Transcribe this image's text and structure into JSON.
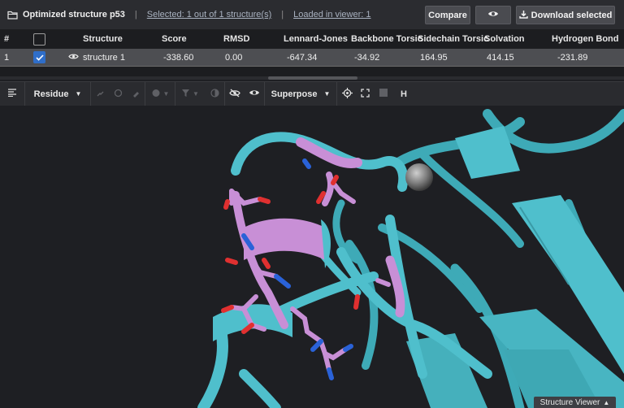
{
  "header": {
    "title": "Optimized structure p53",
    "selected_text": "Selected: 1 out of 1 structure(s)",
    "loaded_text": "Loaded in viewer: 1",
    "separator": "|",
    "compare_label": "Compare",
    "download_label": "Download selected"
  },
  "table": {
    "columns": [
      "#",
      "",
      "Structure",
      "Score",
      "RMSD",
      "Lennard-Jones",
      "Backbone Torsic",
      "Sidechain Torsic",
      "Solvation",
      "Hydrogen Bond"
    ],
    "rows": [
      {
        "index": "1",
        "checked": true,
        "structure": "structure 1",
        "score": "-338.60",
        "rmsd": "0.00",
        "lj": "-647.34",
        "backbone": "-34.92",
        "sidechain": "164.95",
        "solvation": "414.15",
        "hbond": "-231.89"
      }
    ]
  },
  "toolbar": {
    "residue_label": "Residue",
    "superpose_label": "Superpose",
    "h_label": "H"
  },
  "viewer": {
    "tab_label": "Structure Viewer",
    "ribbon_color": "#4fbfcc",
    "highlight_color": "#c88fd6",
    "oxygen_color": "#e03030",
    "nitrogen_color": "#2a62d8",
    "background": "#1e1f23"
  },
  "icons": {
    "title": "folder-icon",
    "compare_eye": "eye-icon",
    "download": "download-icon",
    "row_eye": "eye-icon"
  }
}
